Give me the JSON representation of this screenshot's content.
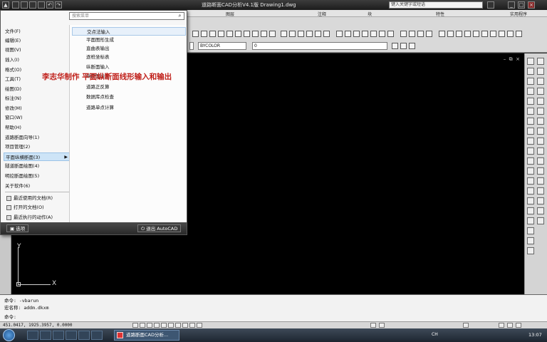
{
  "titlebar": {
    "title": "道路断面CAD分析V4.1版 Drawing1.dwg",
    "search_placeholder": "键入关键字或短语"
  },
  "ribbon": {
    "panels": [
      "图层",
      "注释",
      "块",
      "特性",
      "实用程序"
    ],
    "color_combo": "BYCOLOR",
    "layer_combo": "0"
  },
  "menu": {
    "search_placeholder": "搜索菜单",
    "items": [
      {
        "label": "文件(F)"
      },
      {
        "label": "编辑(E)"
      },
      {
        "label": "视图(V)"
      },
      {
        "label": "插入(I)"
      },
      {
        "label": "格式(O)"
      },
      {
        "label": "工具(T)"
      },
      {
        "label": "绘图(D)"
      },
      {
        "label": "标注(N)"
      },
      {
        "label": "修改(M)"
      },
      {
        "label": "窗口(W)"
      },
      {
        "label": "帮助(H)"
      },
      {
        "label": "道路断面向导(1)"
      },
      {
        "label": "项目管理(2)"
      },
      {
        "label": "平面纵横断面(3)",
        "selected": true,
        "has_submenu": true
      },
      {
        "label": "隧道断面绘图(4)"
      },
      {
        "label": "明挖断面绘图(5)"
      },
      {
        "label": "关于软件(6)"
      }
    ],
    "recent": [
      {
        "label": "最近使用的文档(R)"
      },
      {
        "label": "打开的文档(O)"
      },
      {
        "label": "最近执行的动作(A)"
      }
    ],
    "submenu": [
      {
        "label": "交点法输入",
        "hover": true
      },
      {
        "label": "平面图形生成"
      },
      {
        "label": "直曲表输出"
      },
      {
        "label": "逐桩坐标表"
      },
      {
        "label": "纵断面输入"
      },
      {
        "label": "纵断面绘图"
      },
      {
        "label": "道路正反算"
      },
      {
        "label": "数据库点检查"
      },
      {
        "label": "道路单点计算"
      }
    ],
    "options_label": "选项",
    "exit_label": "退出 AutoCAD"
  },
  "watermark": "李志华制作 平面纵断面线形输入和输出",
  "command": {
    "line1": "命令: -vbarun",
    "line2": "宏名称: addm.dkxm",
    "prompt": "命令:"
  },
  "status": {
    "coords": "451.0417,  1925.3957, 0.0000"
  },
  "taskbar": {
    "task_label": "道路断面CAD分析...",
    "lang": "CH",
    "time": "13:07"
  },
  "ucs": {
    "x": "X",
    "y": "Y"
  }
}
